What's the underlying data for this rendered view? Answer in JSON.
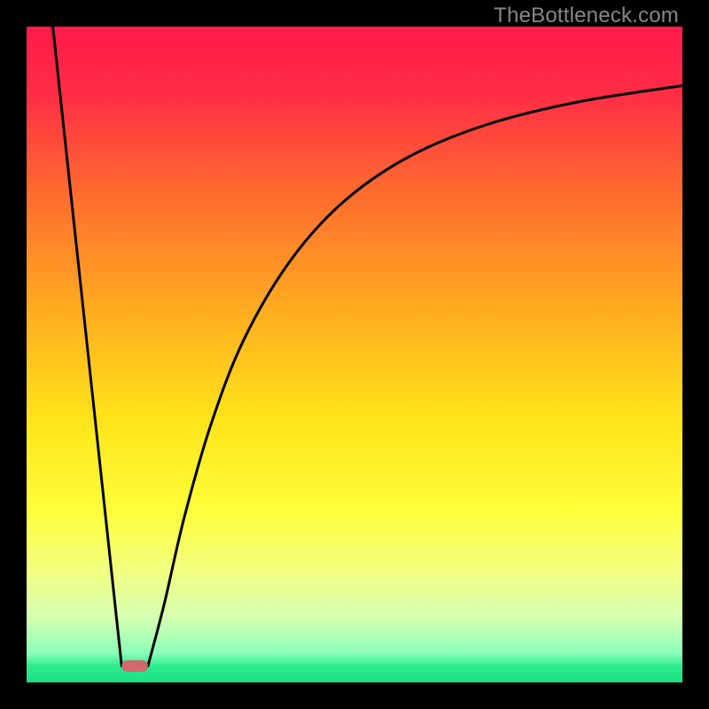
{
  "watermark": "TheBottleneck.com",
  "chart_data": {
    "type": "line",
    "title": "",
    "xlabel": "",
    "ylabel": "",
    "xlim": [
      0,
      100
    ],
    "ylim": [
      0,
      100
    ],
    "grid": false,
    "legend": false,
    "gradient_stops": [
      {
        "pos": 0.0,
        "color": "#ff1a4a"
      },
      {
        "pos": 0.1,
        "color": "#ff2c45"
      },
      {
        "pos": 0.25,
        "color": "#ff6a2f"
      },
      {
        "pos": 0.45,
        "color": "#ffb21e"
      },
      {
        "pos": 0.6,
        "color": "#ffe41a"
      },
      {
        "pos": 0.74,
        "color": "#fdff3a"
      },
      {
        "pos": 0.83,
        "color": "#f2ff80"
      },
      {
        "pos": 0.9,
        "color": "#d6ffb0"
      },
      {
        "pos": 0.955,
        "color": "#8cffb9"
      },
      {
        "pos": 0.975,
        "color": "#2eec8e"
      },
      {
        "pos": 1.0,
        "color": "#19e183"
      }
    ],
    "series": [
      {
        "name": "bottleneck-curve-left",
        "x": [
          4.0,
          14.5
        ],
        "y": [
          100,
          2.5
        ]
      },
      {
        "name": "bottleneck-curve-right",
        "x": [
          18.5,
          21,
          24,
          28,
          33,
          40,
          48,
          58,
          70,
          84,
          100
        ],
        "y": [
          2.5,
          12,
          25,
          39,
          52,
          64,
          73,
          80,
          85,
          88.5,
          91
        ]
      }
    ],
    "marker": {
      "name": "optimal-segment",
      "x": [
        14.5,
        18.5
      ],
      "y": 2.5,
      "color": "#cf6a6d"
    }
  }
}
